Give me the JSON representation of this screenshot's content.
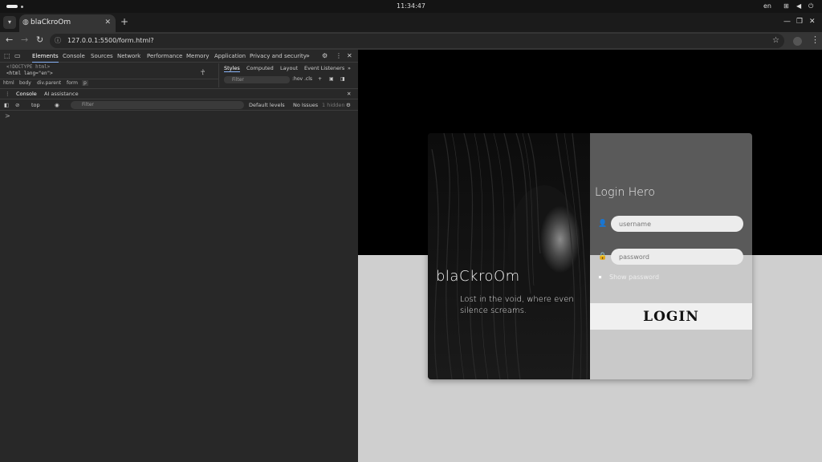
{
  "system_bar": {
    "clock": "11:34:47",
    "lang": "en"
  },
  "browser": {
    "tab_title": "blaCkroOm",
    "url": "127.0.0.1:5500/form.html?"
  },
  "devtools": {
    "tabs": [
      "Elements",
      "Console",
      "Sources",
      "Network",
      "Performance",
      "Memory",
      "Application",
      "Privacy and security"
    ],
    "active_tab": "Elements",
    "dom_lines": [
      "<!DOCTYPE html>",
      "<html lang=\"en\">"
    ],
    "breadcrumbs": [
      "html",
      "body",
      "div.parent",
      "form",
      "p"
    ],
    "styles_tabs": [
      "Styles",
      "Computed",
      "Layout",
      "Event Listeners"
    ],
    "styles_filter_placeholder": "Filter",
    "hov_label": ":hov",
    "cls_label": ".cls",
    "drawer_tabs": [
      "Console",
      "AI assistance"
    ],
    "console_context": "top",
    "console_filter_placeholder": "Filter",
    "levels_label": "Default levels",
    "issues_label": "No Issues",
    "hidden_label": "1 hidden",
    "prompt": ">"
  },
  "page": {
    "brand": "blaCkroOm",
    "tagline": "Lost in the void, where even silence screams.",
    "form_title": "Login Hero",
    "username_placeholder": "username",
    "password_placeholder": "password",
    "show_password_label": "Show password",
    "login_label": "LOGIN"
  }
}
